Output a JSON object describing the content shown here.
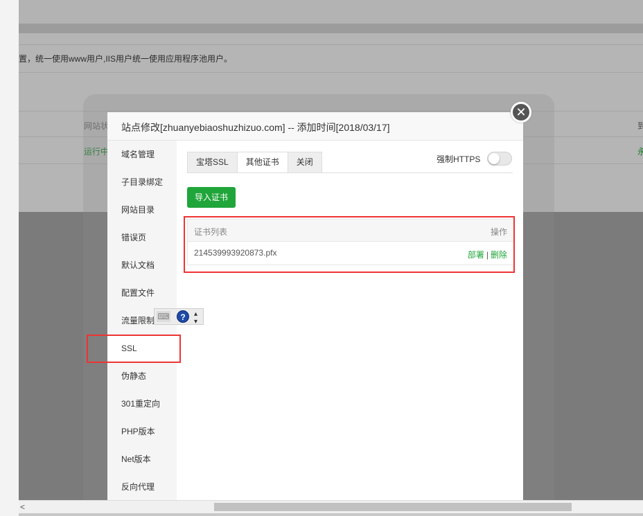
{
  "background": {
    "note_text": "置，统一使用www用户,IIS用户统一使用应用程序池用户。",
    "table_col1_header": "网站状",
    "table_col1_value": "运行中",
    "table_col2_header": "到",
    "table_col2_value": "永"
  },
  "dialog": {
    "title": "站点修改[zhuanyebiaoshuzhizuo.com] -- 添加时间[2018/03/17]",
    "close_icon": "close-icon",
    "sidebar": {
      "items": [
        {
          "label": "域名管理"
        },
        {
          "label": "子目录绑定"
        },
        {
          "label": "网站目录"
        },
        {
          "label": "错误页"
        },
        {
          "label": "默认文档"
        },
        {
          "label": "配置文件"
        },
        {
          "label": "流量限制"
        },
        {
          "label": "SSL"
        },
        {
          "label": "伪静态"
        },
        {
          "label": "301重定向"
        },
        {
          "label": "PHP版本"
        },
        {
          "label": "Net版本"
        },
        {
          "label": "反向代理"
        }
      ]
    },
    "tabs": [
      {
        "label": "宝塔SSL"
      },
      {
        "label": "其他证书"
      },
      {
        "label": "关闭"
      }
    ],
    "active_tab": "其他证书",
    "force_https_label": "强制HTTPS",
    "force_https_enabled": false,
    "import_button": "导入证书",
    "cert_table": {
      "headers": {
        "name": "证书列表",
        "action": "操作"
      },
      "rows": [
        {
          "name": "214539993920873.pfx",
          "deploy": "部署",
          "separator": "|",
          "delete": "删除"
        }
      ]
    }
  },
  "floating_toolbar": {
    "keyboard_icon": "keyboard-icon",
    "help_icon": "help-icon",
    "help_glyph": "?",
    "dropdown_icon": "chevron-updown-icon"
  },
  "colors": {
    "accent_green": "#20a53a",
    "highlight_red": "#e33333"
  }
}
